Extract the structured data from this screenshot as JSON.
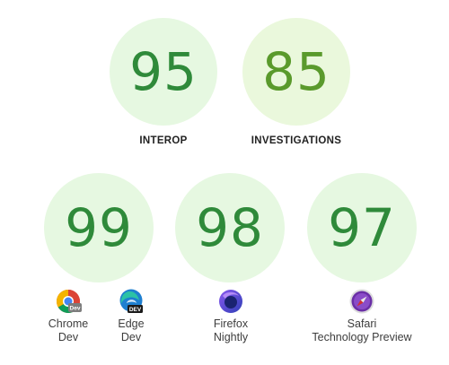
{
  "colors": {
    "circle_bg": "#e6f8e1",
    "circle_bg_investigations": "#eaf8dc",
    "score_text": "#2f8a3a",
    "score_text_investigations": "#5a9a2c"
  },
  "summary": [
    {
      "score": "95",
      "label": "INTEROP"
    },
    {
      "score": "85",
      "label": "INVESTIGATIONS"
    }
  ],
  "browsers": [
    {
      "score": "99",
      "icon": "chrome-dev-icon",
      "name_line1": "Chrome",
      "name_line2": "Dev"
    },
    {
      "score": "98",
      "icon": "firefox-nightly-icon",
      "name_line1": "Firefox",
      "name_line2": "Nightly"
    },
    {
      "score": "97",
      "icon": "safari-technology-preview-icon",
      "name_line1": "Safari",
      "name_line2": "Technology Preview"
    }
  ],
  "edge": {
    "icon": "edge-dev-icon",
    "name_line1": "Edge",
    "name_line2": "Dev",
    "badge": "DEV"
  },
  "chrome_badge": "Dev"
}
